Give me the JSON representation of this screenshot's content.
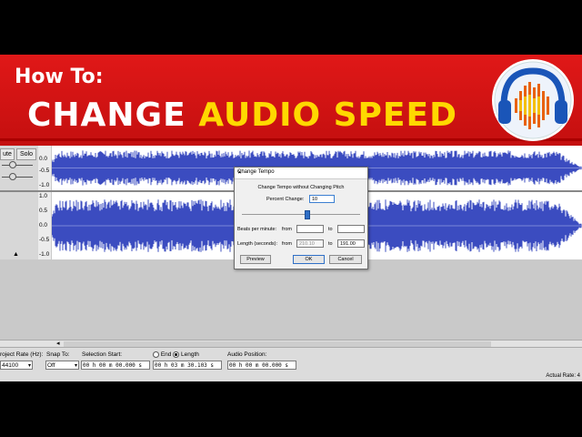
{
  "thumbnail": {
    "how_to": "How To:",
    "headline_white": "CHANGE ",
    "headline_yellow": "AUDIO SPEED"
  },
  "track": {
    "mute_label": "ute",
    "solo_label": "Solo",
    "ruler_top": [
      "0.0",
      "-0.5",
      "-1.0"
    ],
    "ruler_bottom": [
      "1.0",
      "0.5",
      "0.0",
      "-0.5",
      "-1.0"
    ],
    "wave_color": "#3b4cc0"
  },
  "dialog": {
    "title": "Change Tempo",
    "close": "✕",
    "heading": "Change Tempo without Changing Pitch",
    "percent_label": "Percent Change:",
    "percent_value": "10",
    "slider_fraction": 0.55,
    "bpm_label": "Beats per minute:",
    "bpm_from_label": "from",
    "bpm_from_value": "",
    "bpm_to_label": "to",
    "bpm_to_value": "",
    "length_label": "Length (seconds):",
    "length_from_label": "from",
    "length_from_value": "210.10",
    "length_to_label": "to",
    "length_to_value": "191.00",
    "preview_label": "Preview",
    "ok_label": "OK",
    "cancel_label": "Cancel"
  },
  "selection_toolbar": {
    "project_rate_label": "roject Rate (Hz):",
    "project_rate_value": "44100",
    "snap_label": "Snap To:",
    "snap_value": "Off",
    "selection_start_label": "Selection Start:",
    "selection_start_value": "00 h 00 m 00.000 s",
    "end_label": "End",
    "length_label": "Length",
    "length_value": "00 h 03 m 30.103 s",
    "audio_position_label": "Audio Position:",
    "audio_position_value": "00 h 00 m 00.000 s"
  },
  "status_bar": {
    "actual_rate": "Actual Rate: 4"
  }
}
